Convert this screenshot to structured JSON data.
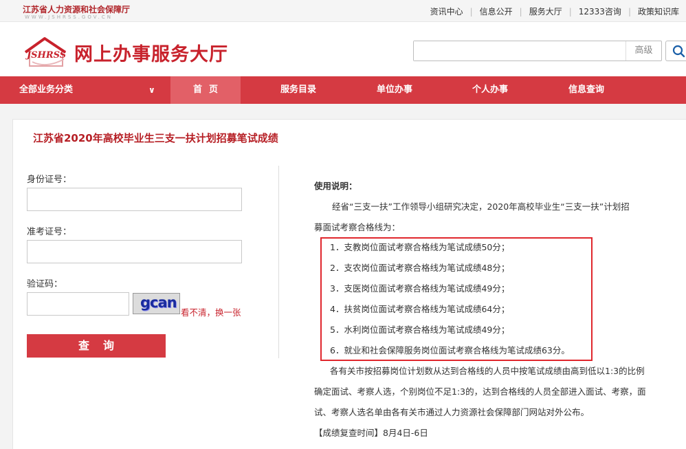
{
  "topbar": {
    "site_name": "江苏省人力资源和社会保障厅",
    "site_url": "WWW.JSHRSS.GOV.CN",
    "links": [
      "资讯中心",
      "信息公开",
      "服务大厅",
      "12333咨询",
      "政策知识库"
    ]
  },
  "header": {
    "logo_mark": "JSHRSS",
    "logo_title": "网上办事服务大厅",
    "search_placeholder": "",
    "search_advanced": "高级"
  },
  "nav": {
    "all": "全部业务分类",
    "home": "首页",
    "catalog": "服务目录",
    "unit": "单位办事",
    "personal": "个人办事",
    "info": "信息查询"
  },
  "page": {
    "title": "江苏省2020年高校毕业生三支一扶计划招募笔试成绩"
  },
  "form": {
    "id_label": "身份证号：",
    "id_value": "",
    "exam_label": "准考证号：",
    "exam_value": "",
    "captcha_label": "验证码：",
    "captcha_value": "",
    "captcha_text": "gcan",
    "captcha_refresh": "看不清，换一张",
    "submit": "查询"
  },
  "instructions": {
    "title": "使用说明：",
    "intro_1": "经省“三支一扶”工作领导小组研究决定，2020年高校毕业生“三支一扶”计划招",
    "intro_2": "募面试考察合格线为：",
    "items": [
      "1．支教岗位面试考察合格线为笔试成绩50分；",
      "2．支农岗位面试考察合格线为笔试成绩48分；",
      "3．支医岗位面试考察合格线为笔试成绩49分；",
      "4．扶贫岗位面试考察合格线为笔试成绩64分；",
      "5．水利岗位面试考察合格线为笔试成绩49分；",
      "6．就业和社会保障服务岗位面试考察合格线为笔试成绩63分。"
    ],
    "note_1": "各有关市按招募岗位计划数从达到合格线的人员中按笔试成绩由高到低以1:3的比例",
    "note_2": "确定面试、考察人选，个别岗位不足1:3的，达到合格线的人员全部进入面试、考察，面",
    "note_3": "试、考察人选名单由各有关市通过人力资源社会保障部门网站对外公布。",
    "review": "【成绩复查时间】8月4日-6日"
  },
  "colors": {
    "brand_red": "#d53a42",
    "title_red": "#b61f25"
  }
}
